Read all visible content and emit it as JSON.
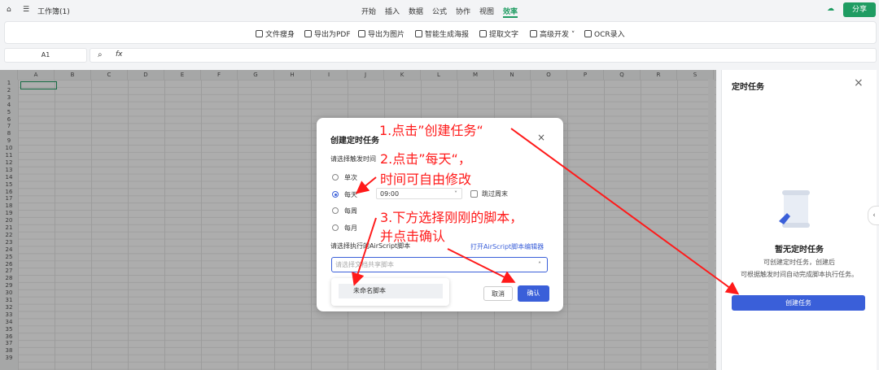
{
  "app": {
    "title": "工作簿(1)",
    "share_label": "分享"
  },
  "menu": [
    "开始",
    "插入",
    "数据",
    "公式",
    "协作",
    "视图",
    "效率"
  ],
  "toolbar": [
    {
      "label": "文件瘦身",
      "icon": "slim-icon"
    },
    {
      "label": "导出为PDF",
      "icon": "pdf-icon"
    },
    {
      "label": "导出为图片",
      "icon": "image-icon"
    },
    {
      "label": "智能生成海报",
      "icon": "poster-icon"
    },
    {
      "label": "提取文字",
      "icon": "extract-text-icon"
    },
    {
      "label": "高级开发",
      "icon": "dev-icon"
    },
    {
      "label": "OCR录入",
      "icon": "ocr-icon"
    }
  ],
  "formula": {
    "cell_ref": "A1",
    "fx_label": "fx"
  },
  "grid": {
    "columns": [
      "A",
      "B",
      "C",
      "D",
      "E",
      "F",
      "G",
      "H",
      "I",
      "J",
      "K",
      "L",
      "M",
      "N",
      "O",
      "P",
      "Q",
      "R",
      "S"
    ],
    "rows": [
      "1",
      "2",
      "3",
      "4",
      "5",
      "6",
      "7",
      "8",
      "9",
      "10",
      "11",
      "12",
      "13",
      "14",
      "15",
      "16",
      "17",
      "18",
      "19",
      "20",
      "21",
      "22",
      "23",
      "24",
      "25",
      "26",
      "27",
      "28",
      "29",
      "30",
      "31",
      "32",
      "33",
      "34",
      "35",
      "36",
      "37",
      "38",
      "39"
    ]
  },
  "panel": {
    "title": "定时任务",
    "empty_title": "暂无定时任务",
    "empty_desc1": "可创建定时任务，创建后",
    "empty_desc2": "可根据触发时间自动完成脚本执行任务。",
    "create_label": "创建任务"
  },
  "dialog": {
    "title": "创建定时任务",
    "trigger_label": "请选择触发时间",
    "options": [
      "单次",
      "每天",
      "每周",
      "每月"
    ],
    "selected": "每天",
    "time_value": "09:00",
    "skip_weekend": "跳过周末",
    "script_label": "请选择执行的AirScript脚本",
    "open_editor": "打开AirScript脚本编辑器",
    "script_placeholder": "请选择文档共享脚本",
    "dropdown_item": "未命名脚本",
    "cancel": "取消",
    "confirm": "确认"
  },
  "annotations": {
    "step1": "1.点击”创建任务“",
    "step2a": "2.点击”每天“，",
    "step2b": "时间可自由修改",
    "step3a": "3.下方选择刚刚的脚本，",
    "step3b": "并点击确认"
  },
  "colors": {
    "accent": "#1f9c62",
    "primary": "#3a5fd9",
    "annotation": "#ff1a1a"
  }
}
